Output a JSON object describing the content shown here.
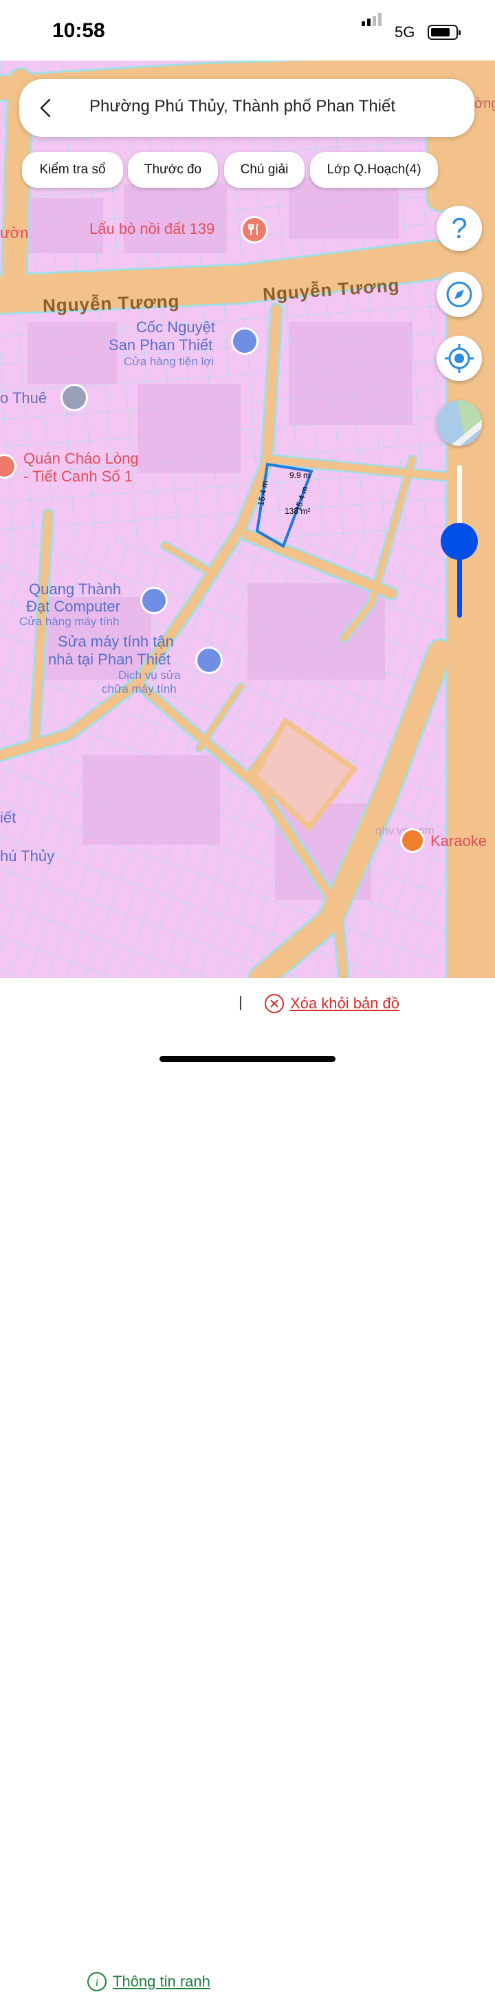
{
  "status_bar": {
    "time": "10:58",
    "network": "5G"
  },
  "header": {
    "location_title": "Phường Phú Thủy, Thành phố Phan Thiết"
  },
  "chips": [
    "Kiểm tra sổ",
    "Thước đo",
    "Chú giải",
    "Lớp Q.Hoạch(4)"
  ],
  "map_labels": {
    "road1": "Nguyễn Tương",
    "road2": "Nguyễn Tương",
    "poi_restaurant": "Lẩu bò nồi đất 139",
    "poi_truong": "ườn",
    "poi_store_l1": "Cốc Nguyệt",
    "poi_store_l2": "San Phan Thiết",
    "poi_store_sub": "Cửa hàng tiện lợi",
    "poi_thue": "o Thuê",
    "poi_chao_l1": "Quán Cháo Lòng",
    "poi_chao_l2": "- Tiết Canh Số 1",
    "poi_computer_l1": "Quang Thành",
    "poi_computer_l2": "Đạt Computer",
    "poi_computer_sub": "Cửa hàng máy tính",
    "poi_repair_l1": "Sửa máy tính tận",
    "poi_repair_l2": "nhà tại Phan Thiết",
    "poi_repair_sub1": "Dịch vụ sửa",
    "poi_repair_sub2": "chữa máy tính",
    "poi_karaoke": "Karaoke",
    "area_iet": "iết",
    "area_phuthuy": "hú Thủy",
    "watermark": "qhv.vn.com",
    "top_right": "ờng"
  },
  "parcel": {
    "side_top": "9.9 m",
    "side_left": "15.4 m",
    "side_right": "15.4 m",
    "area": "138 m²"
  },
  "zoom_level": 0.5,
  "bottom_bar": {
    "info_link": "Thông tin ranh",
    "separator": "|",
    "remove_link": "Xóa khỏi bản đồ"
  },
  "colors": {
    "land": "#f3c6f3",
    "road": "#f2c28a",
    "parcel_border": "#1f7ae0",
    "accent_blue": "#0050e8"
  }
}
